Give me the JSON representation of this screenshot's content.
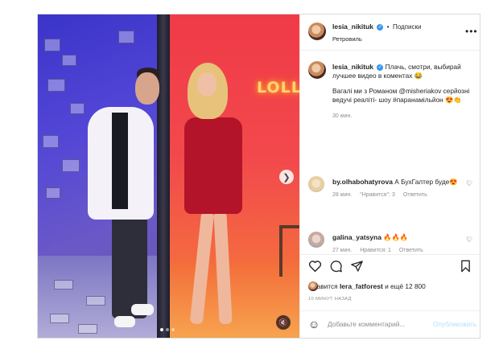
{
  "post": {
    "author": "lesia_nikituk",
    "follow_label": "Подписки",
    "separator": "•",
    "location": "Ретровиль",
    "more_icon": "more-horizontal-icon",
    "next_icon": "chevron-right-icon",
    "sound_icon": "sound-muted-icon",
    "neon_sign": "LOLL",
    "carousel_index": 1,
    "carousel_count": 3
  },
  "caption": {
    "author": "lesia_nikituk",
    "line1": "Плачь, смотри, выбирай лучшее видео в коментах 😂",
    "line2": "Вагалі ми з Романом @misheriakov серйозні ведучі реаліті- шоу #паранамільйон 😍👏",
    "time": "30 мин."
  },
  "comments": [
    {
      "author": "by.olhabohatyrova",
      "text": "А БухГалтер буде😍",
      "time": "28 мин.",
      "likes": "\"Нравится\": 3",
      "reply": "Ответить"
    },
    {
      "author": "galina_yatsyna",
      "text": "🔥🔥🔥",
      "time": "27 мин.",
      "likes": "Нравится: 1",
      "reply": "Ответить"
    }
  ],
  "actions": {
    "like_icon": "heart-icon",
    "comment_icon": "comment-icon",
    "share_icon": "share-icon",
    "save_icon": "bookmark-icon"
  },
  "likes": {
    "prefix": "Нравится",
    "user": "lera_fatforest",
    "suffix": "и ещё 12 800"
  },
  "posted_ago": "10 МИНУТ НАЗАД",
  "add_comment": {
    "placeholder": "Добавьте комментарий...",
    "publish_label": "Опубликовать",
    "emoji_icon": "emoji-icon"
  },
  "colors": {
    "verified": "#3897f0",
    "publish": "#b2dffc",
    "muted_text": "#8e8e8e"
  }
}
